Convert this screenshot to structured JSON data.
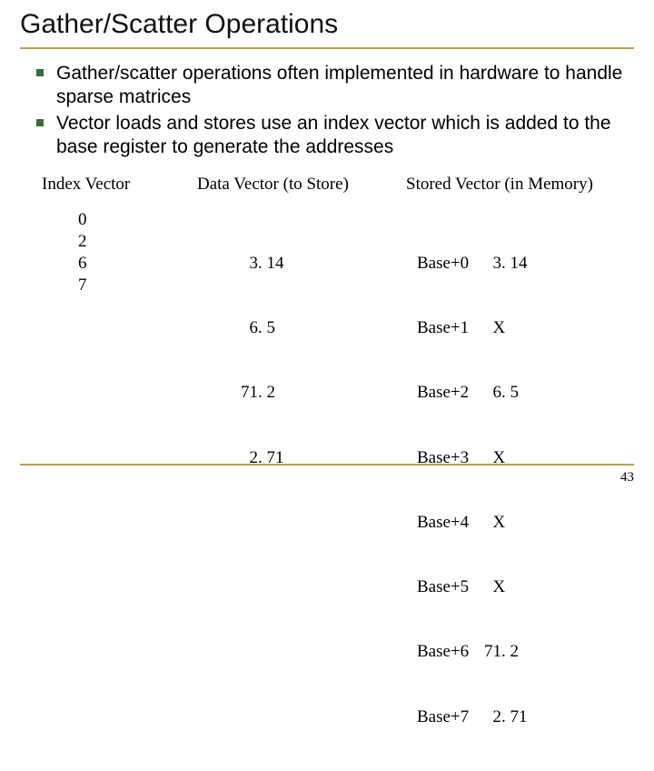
{
  "title": "Gather/Scatter Operations",
  "bullets": [
    "Gather/scatter operations often implemented in hardware to handle sparse matrices",
    "Vector loads and stores use an index vector which is added to the base register to generate the addresses"
  ],
  "columns": {
    "index": {
      "header": "Index Vector",
      "values": [
        "0",
        "2",
        "6",
        "7"
      ]
    },
    "data": {
      "header": "Data Vector (to Store)",
      "values": [
        "  3. 14",
        "  6. 5",
        "71. 2",
        "  2. 71"
      ]
    },
    "stored": {
      "header": "Stored Vector (in Memory)",
      "rows": [
        {
          "addr": "Base+0",
          "val": "  3. 14"
        },
        {
          "addr": "Base+1",
          "val": "  X"
        },
        {
          "addr": "Base+2",
          "val": "  6. 5"
        },
        {
          "addr": "Base+3",
          "val": "  X"
        },
        {
          "addr": "Base+4",
          "val": "  X"
        },
        {
          "addr": "Base+5",
          "val": "  X"
        },
        {
          "addr": "Base+6",
          "val": "71. 2"
        },
        {
          "addr": "Base+7",
          "val": "  2. 71"
        }
      ]
    }
  },
  "page_number": "43"
}
